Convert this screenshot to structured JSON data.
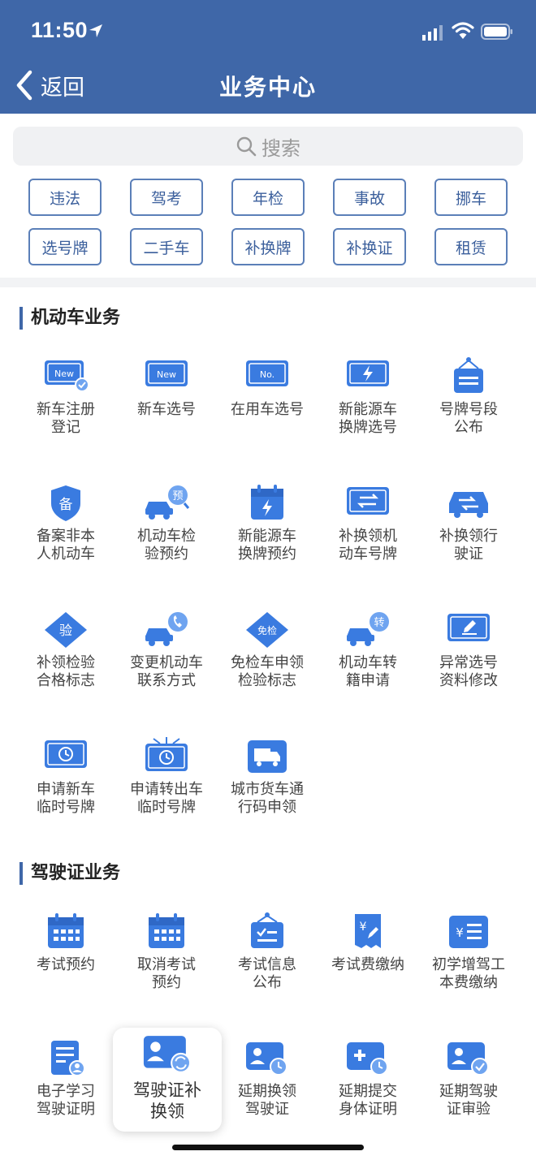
{
  "status": {
    "time": "11:50"
  },
  "nav": {
    "back_label": "返回",
    "title": "业务中心"
  },
  "search": {
    "placeholder": "搜索"
  },
  "chips": [
    "违法",
    "驾考",
    "年检",
    "事故",
    "挪车",
    "选号牌",
    "二手车",
    "补换牌",
    "补换证",
    "租赁"
  ],
  "sections": {
    "motor": {
      "title": "机动车业务",
      "items": [
        {
          "label": "新车注册\n登记",
          "icon": "new-plate-check-icon"
        },
        {
          "label": "新车选号",
          "icon": "new-plate-icon"
        },
        {
          "label": "在用车选号",
          "icon": "no-plate-icon"
        },
        {
          "label": "新能源车\n换牌选号",
          "icon": "ev-plate-icon"
        },
        {
          "label": "号牌号段\n公布",
          "icon": "plate-sign-icon"
        },
        {
          "label": "备案非本\n人机动车",
          "icon": "record-shield-icon"
        },
        {
          "label": "机动车检\n验预约",
          "icon": "car-inspect-icon"
        },
        {
          "label": "新能源车\n换牌预约",
          "icon": "ev-calendar-icon"
        },
        {
          "label": "补换领机\n动车号牌",
          "icon": "plate-swap-icon"
        },
        {
          "label": "补换领行\n驶证",
          "icon": "car-swap-icon"
        },
        {
          "label": "补领检验\n合格标志",
          "icon": "verify-diamond-icon"
        },
        {
          "label": "变更机动车\n联系方式",
          "icon": "car-phone-icon"
        },
        {
          "label": "免检车申领\n检验标志",
          "icon": "exempt-diamond-icon"
        },
        {
          "label": "机动车转\n籍申请",
          "icon": "car-transfer-icon"
        },
        {
          "label": "异常选号\n资料修改",
          "icon": "plate-edit-icon"
        },
        {
          "label": "申请新车\n临时号牌",
          "icon": "temp-plate-icon"
        },
        {
          "label": "申请转出车\n临时号牌",
          "icon": "temp-plate-out-icon"
        },
        {
          "label": "城市货车通\n行码申领",
          "icon": "truck-icon"
        }
      ]
    },
    "license": {
      "title": "驾驶证业务",
      "items": [
        {
          "label": "考试预约",
          "icon": "calendar-icon"
        },
        {
          "label": "取消考试\n预约",
          "icon": "calendar-cancel-icon"
        },
        {
          "label": "考试信息\n公布",
          "icon": "exam-info-icon"
        },
        {
          "label": "考试费缴纳",
          "icon": "exam-fee-icon"
        },
        {
          "label": "初学增驾工\n本费缴纳",
          "icon": "fee-list-icon"
        },
        {
          "label": "电子学习\n驾驶证明",
          "icon": "e-doc-icon"
        },
        {
          "label": "驾驶证补\n换领",
          "icon": "license-renew-icon"
        },
        {
          "label": "延期换领\n驾驶证",
          "icon": "license-delay-icon"
        },
        {
          "label": "延期提交\n身体证明",
          "icon": "health-delay-icon"
        },
        {
          "label": "延期驾驶\n证审验",
          "icon": "license-verify-icon"
        }
      ]
    }
  },
  "colors": {
    "brand": "#3f67a8",
    "icon_blue": "#3a7be0"
  }
}
